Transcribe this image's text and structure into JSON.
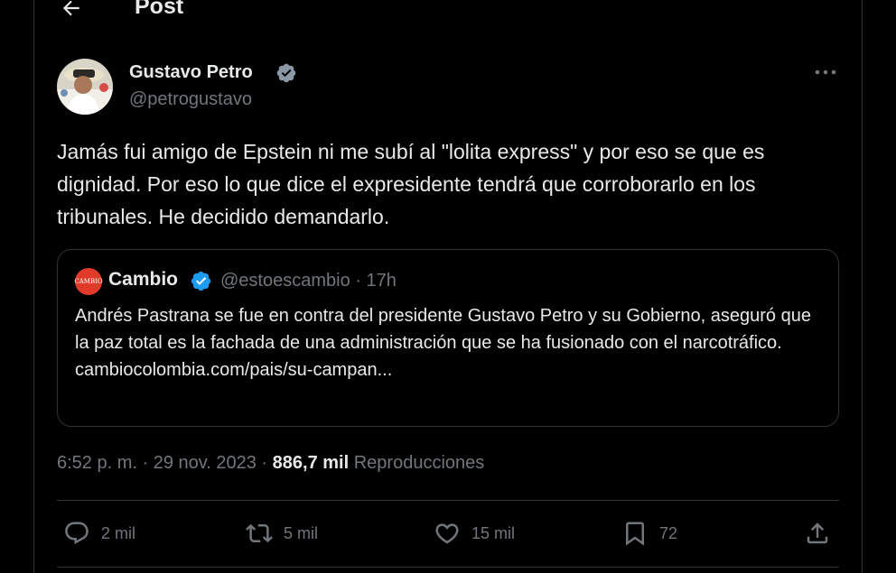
{
  "header": {
    "title": "Post",
    "back_icon": "arrow-left-icon"
  },
  "author": {
    "name": "Gustavo Petro",
    "handle": "@petrogustavo",
    "verified": true,
    "verified_color": "#8b98a5"
  },
  "tweet": {
    "text": "Jamás fui amigo de Epstein ni me subí al \"lolita express\" y por eso se que es dignidad. Por eso lo que dice el expresidente tendrá que corroborarlo en los tribunales. He decidido demandarlo."
  },
  "quote": {
    "avatar_text": "CAMBIO",
    "name": "Cambio",
    "verified": true,
    "verified_color": "#1d9bf0",
    "handle_time": "@estoescambio · 17h",
    "text": "Andrés Pastrana se fue en contra del presidente Gustavo Petro y su Gobierno, aseguró que la paz total es la fachada de una administración que se ha fusionado con el narcotráfico.",
    "link": "cambiocolombia.com/pais/su-campan..."
  },
  "meta": {
    "time_date": "6:52 p. m. · 29 nov. 2023 · ",
    "views_count": "886,7 mil",
    "views_label": "Reproducciones"
  },
  "actions": {
    "replies": "2 mil",
    "retweets": "5 mil",
    "likes": "15 mil",
    "bookmarks": "72"
  },
  "colors": {
    "background": "#000000",
    "text": "#e7e9ea",
    "secondary": "#71767b",
    "border": "#2f3336",
    "accent": "#1d9bf0"
  }
}
